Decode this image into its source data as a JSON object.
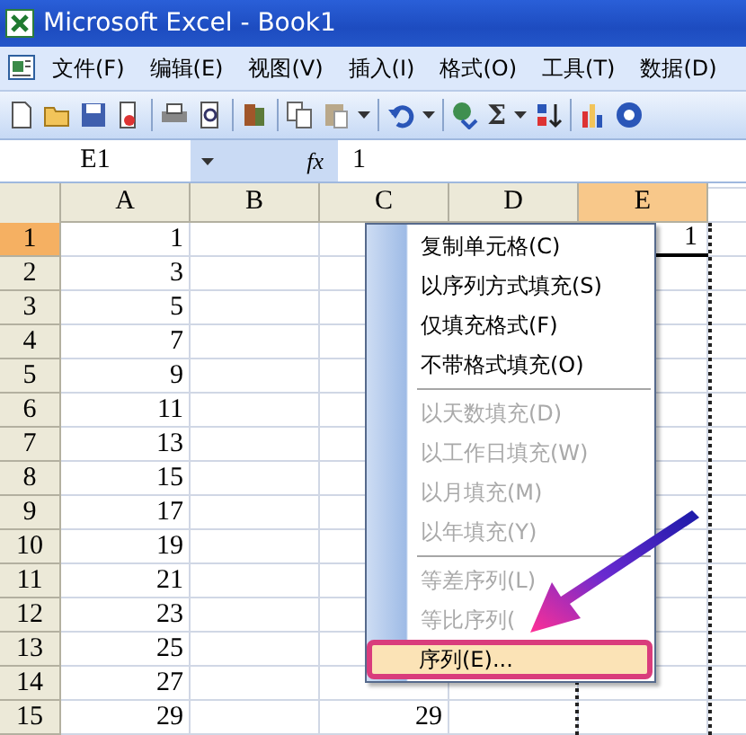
{
  "window": {
    "title": "Microsoft Excel - Book1"
  },
  "menubar": [
    "文件(F)",
    "编辑(E)",
    "视图(V)",
    "插入(I)",
    "格式(O)",
    "工具(T)",
    "数据(D)"
  ],
  "toolbar": {
    "sum": "Σ"
  },
  "formula_bar": {
    "name_box": "E1",
    "function_label": "fx",
    "value": "1"
  },
  "sheet": {
    "columns": [
      {
        "label": "A",
        "selected": false
      },
      {
        "label": "B",
        "selected": false
      },
      {
        "label": "C",
        "selected": false
      },
      {
        "label": "D",
        "selected": false
      },
      {
        "label": "E",
        "selected": true
      }
    ],
    "rows": [
      {
        "header": "1",
        "selected": true,
        "cells": [
          "1",
          "",
          "",
          "",
          "1"
        ]
      },
      {
        "header": "2",
        "selected": false,
        "cells": [
          "3",
          "",
          "",
          "",
          ""
        ]
      },
      {
        "header": "3",
        "selected": false,
        "cells": [
          "5",
          "",
          "",
          "",
          ""
        ]
      },
      {
        "header": "4",
        "selected": false,
        "cells": [
          "7",
          "",
          "",
          "",
          ""
        ]
      },
      {
        "header": "5",
        "selected": false,
        "cells": [
          "9",
          "",
          "",
          "",
          ""
        ]
      },
      {
        "header": "6",
        "selected": false,
        "cells": [
          "11",
          "",
          "",
          "",
          ""
        ]
      },
      {
        "header": "7",
        "selected": false,
        "cells": [
          "13",
          "",
          "",
          "",
          ""
        ]
      },
      {
        "header": "8",
        "selected": false,
        "cells": [
          "15",
          "",
          "",
          "",
          ""
        ]
      },
      {
        "header": "9",
        "selected": false,
        "cells": [
          "17",
          "",
          "",
          "",
          ""
        ]
      },
      {
        "header": "10",
        "selected": false,
        "cells": [
          "19",
          "",
          "",
          "",
          ""
        ]
      },
      {
        "header": "11",
        "selected": false,
        "cells": [
          "21",
          "",
          "",
          "",
          ""
        ]
      },
      {
        "header": "12",
        "selected": false,
        "cells": [
          "23",
          "",
          "",
          "",
          ""
        ]
      },
      {
        "header": "13",
        "selected": false,
        "cells": [
          "25",
          "",
          "",
          "",
          ""
        ]
      },
      {
        "header": "14",
        "selected": false,
        "cells": [
          "27",
          "",
          "",
          "",
          ""
        ]
      },
      {
        "header": "15",
        "selected": false,
        "cells": [
          "29",
          "",
          "29",
          "",
          ""
        ]
      }
    ]
  },
  "context_menu": {
    "items": [
      {
        "kind": "item",
        "label": "复制单元格(C)",
        "disabled": false,
        "selected": false
      },
      {
        "kind": "item",
        "label": "以序列方式填充(S)",
        "disabled": false,
        "selected": false
      },
      {
        "kind": "item",
        "label": "仅填充格式(F)",
        "disabled": false,
        "selected": false
      },
      {
        "kind": "item",
        "label": "不带格式填充(O)",
        "disabled": false,
        "selected": false
      },
      {
        "kind": "separator"
      },
      {
        "kind": "item",
        "label": "以天数填充(D)",
        "disabled": true,
        "selected": false
      },
      {
        "kind": "item",
        "label": "以工作日填充(W)",
        "disabled": true,
        "selected": false
      },
      {
        "kind": "item",
        "label": "以月填充(M)",
        "disabled": true,
        "selected": false
      },
      {
        "kind": "item",
        "label": "以年填充(Y)",
        "disabled": true,
        "selected": false
      },
      {
        "kind": "separator"
      },
      {
        "kind": "item",
        "label": "等差序列(L)",
        "disabled": true,
        "selected": false
      },
      {
        "kind": "item",
        "label": "等比序列(",
        "disabled": true,
        "selected": false
      },
      {
        "kind": "item",
        "label": "序列(E)...",
        "disabled": false,
        "selected": true
      }
    ]
  }
}
